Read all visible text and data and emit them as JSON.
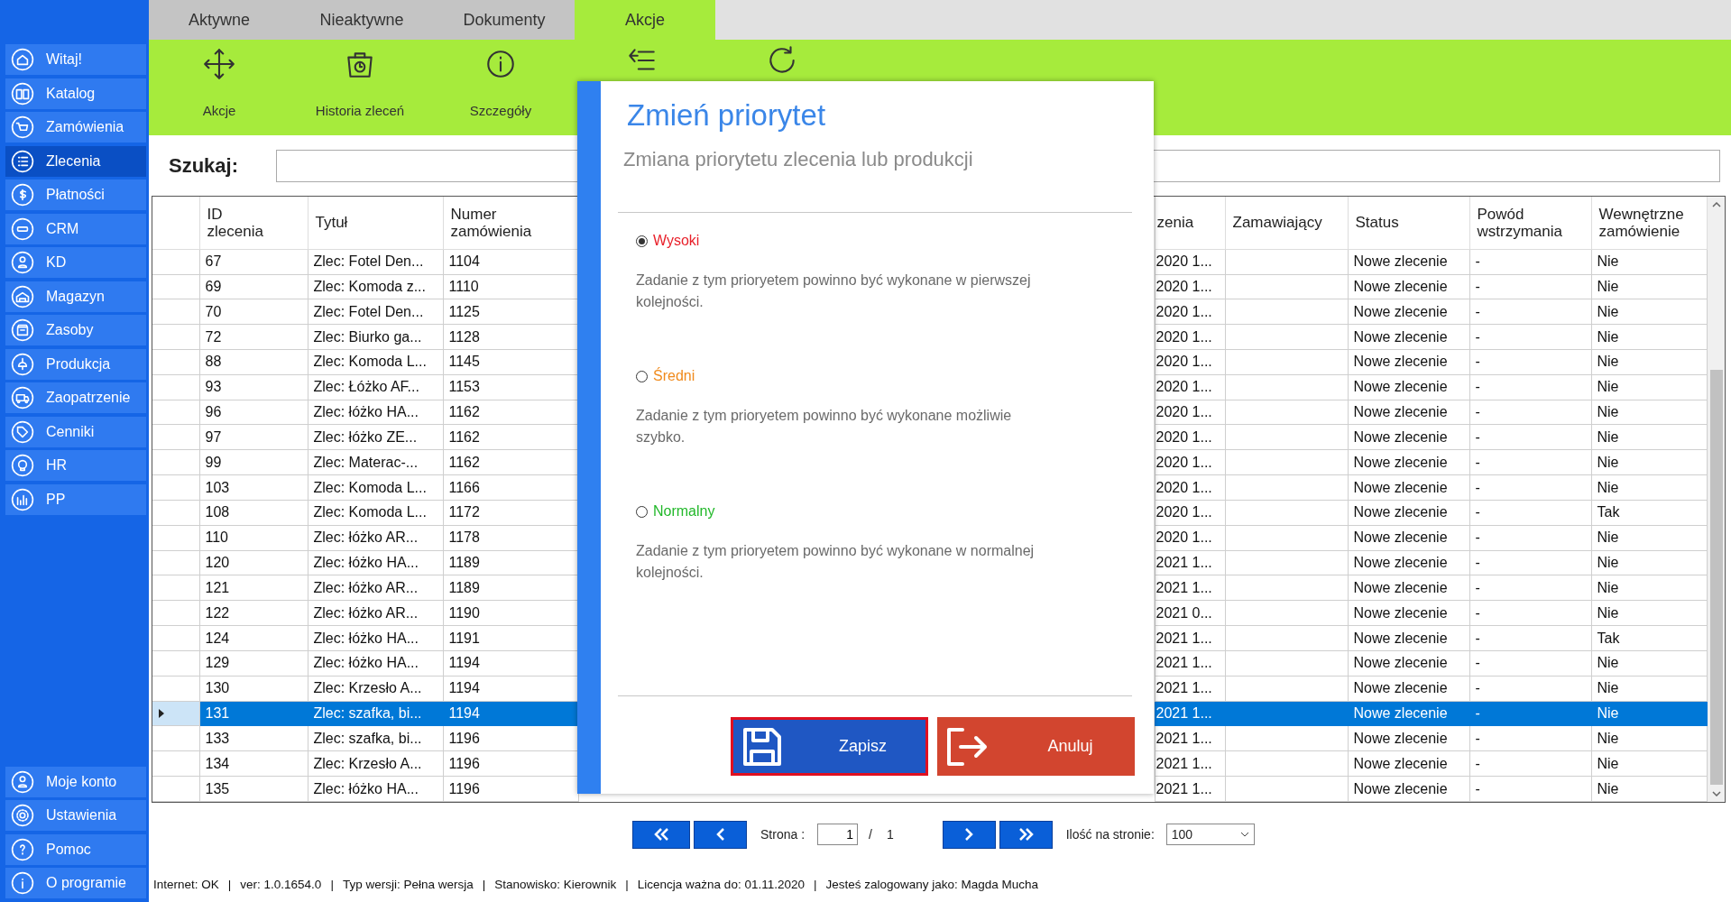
{
  "sidebar": {
    "items": [
      {
        "label": "Witaj!",
        "selected": false
      },
      {
        "label": "Katalog",
        "selected": false
      },
      {
        "label": "Zamówienia",
        "selected": false
      },
      {
        "label": "Zlecenia",
        "selected": true
      },
      {
        "label": "Płatności",
        "selected": false
      },
      {
        "label": "CRM",
        "selected": false
      },
      {
        "label": "KD",
        "selected": false
      },
      {
        "label": "Magazyn",
        "selected": false
      },
      {
        "label": "Zasoby",
        "selected": false
      },
      {
        "label": "Produkcja",
        "selected": false
      },
      {
        "label": "Zaopatrzenie",
        "selected": false
      },
      {
        "label": "Cenniki",
        "selected": false
      },
      {
        "label": "HR",
        "selected": false
      },
      {
        "label": "PP",
        "selected": false
      }
    ],
    "bottom_items": [
      {
        "label": "Moje konto"
      },
      {
        "label": "Ustawienia"
      },
      {
        "label": "Pomoc"
      },
      {
        "label": "O programie"
      }
    ]
  },
  "tabs": [
    {
      "label": "Aktywne",
      "selected": false
    },
    {
      "label": "Nieaktywne",
      "selected": false
    },
    {
      "label": "Dokumenty",
      "selected": false
    },
    {
      "label": "Akcje",
      "selected": true
    }
  ],
  "toolbar": {
    "buttons": [
      {
        "kind": "labeled",
        "label": "Akcje"
      },
      {
        "kind": "labeled",
        "label": "Historia zleceń"
      },
      {
        "kind": "labeled",
        "label": "Szczegóły"
      },
      {
        "kind": "icon_only"
      },
      {
        "kind": "icon_only"
      }
    ]
  },
  "search": {
    "label": "Szukaj:"
  },
  "table": {
    "columns": [
      "ID\nzlecenia",
      "Tytuł",
      "Numer\nzamówienia",
      "zenia",
      "Zamawiający",
      "Status",
      "Powód\nwstrzymania",
      "Wewnętrzne\nzamówienie"
    ],
    "rows": [
      {
        "selected": false,
        "cells": [
          "67",
          "Zlec: Fotel Den...",
          "1104",
          "2020 1...",
          null,
          "Nowe zlecenie",
          "-",
          "Nie"
        ]
      },
      {
        "selected": false,
        "cells": [
          "69",
          "Zlec: Komoda z...",
          "1110",
          "2020 1...",
          null,
          "Nowe zlecenie",
          "-",
          "Nie"
        ]
      },
      {
        "selected": false,
        "cells": [
          "70",
          "Zlec: Fotel Den...",
          "1125",
          "2020 1...",
          null,
          "Nowe zlecenie",
          "-",
          "Nie"
        ]
      },
      {
        "selected": false,
        "cells": [
          "72",
          "Zlec: Biurko ga...",
          "1128",
          "2020 1...",
          null,
          "Nowe zlecenie",
          "-",
          "Nie"
        ]
      },
      {
        "selected": false,
        "cells": [
          "88",
          "Zlec: Komoda L...",
          "1145",
          "2020 1...",
          null,
          "Nowe zlecenie",
          "-",
          "Nie"
        ]
      },
      {
        "selected": false,
        "cells": [
          "93",
          "Zlec: Łóżko AF...",
          "1153",
          "2020 1...",
          null,
          "Nowe zlecenie",
          "-",
          "Nie"
        ]
      },
      {
        "selected": false,
        "cells": [
          "96",
          "Zlec: łóżko HA...",
          "1162",
          "2020 1...",
          null,
          "Nowe zlecenie",
          "-",
          "Nie"
        ]
      },
      {
        "selected": false,
        "cells": [
          "97",
          "Zlec: łóżko ZE...",
          "1162",
          "2020 1...",
          null,
          "Nowe zlecenie",
          "-",
          "Nie"
        ]
      },
      {
        "selected": false,
        "cells": [
          "99",
          "Zlec: Materac-...",
          "1162",
          "2020 1...",
          null,
          "Nowe zlecenie",
          "-",
          "Nie"
        ]
      },
      {
        "selected": false,
        "cells": [
          "103",
          "Zlec: Komoda L...",
          "1166",
          "2020 1...",
          null,
          "Nowe zlecenie",
          "-",
          "Nie"
        ]
      },
      {
        "selected": false,
        "cells": [
          "108",
          "Zlec: Komoda L...",
          "1172",
          "2020 1...",
          null,
          "Nowe zlecenie",
          "-",
          "Tak"
        ]
      },
      {
        "selected": false,
        "cells": [
          "110",
          "Zlec: łóżko AR...",
          "1178",
          "2020 1...",
          null,
          "Nowe zlecenie",
          "-",
          "Nie"
        ]
      },
      {
        "selected": false,
        "cells": [
          "120",
          "Zlec: łóżko HA...",
          "1189",
          "2021 1...",
          null,
          "Nowe zlecenie",
          "-",
          "Nie"
        ]
      },
      {
        "selected": false,
        "cells": [
          "121",
          "Zlec: łóżko AR...",
          "1189",
          "2021 1...",
          null,
          "Nowe zlecenie",
          "-",
          "Nie"
        ]
      },
      {
        "selected": false,
        "cells": [
          "122",
          "Zlec: łóżko AR...",
          "1190",
          "2021 0...",
          null,
          "Nowe zlecenie",
          "-",
          "Nie"
        ]
      },
      {
        "selected": false,
        "cells": [
          "124",
          "Zlec: łóżko HA...",
          "1191",
          "2021 1...",
          null,
          "Nowe zlecenie",
          "-",
          "Tak"
        ]
      },
      {
        "selected": false,
        "cells": [
          "129",
          "Zlec: łóżko HA...",
          "1194",
          "2021 1...",
          null,
          "Nowe zlecenie",
          "-",
          "Nie"
        ]
      },
      {
        "selected": false,
        "cells": [
          "130",
          "Zlec: Krzesło A...",
          "1194",
          "2021 1...",
          null,
          "Nowe zlecenie",
          "-",
          "Nie"
        ]
      },
      {
        "selected": true,
        "cells": [
          "131",
          "Zlec: szafka, bi...",
          "1194",
          "2021 1...",
          null,
          "Nowe zlecenie",
          "-",
          "Nie"
        ]
      },
      {
        "selected": false,
        "cells": [
          "133",
          "Zlec: szafka, bi...",
          "1196",
          "2021 1...",
          null,
          "Nowe zlecenie",
          "-",
          "Nie"
        ]
      },
      {
        "selected": false,
        "cells": [
          "134",
          "Zlec: Krzesło A...",
          "1196",
          "2021 1...",
          null,
          "Nowe zlecenie",
          "-",
          "Nie"
        ]
      },
      {
        "selected": false,
        "cells": [
          "135",
          "Zlec: łóżko HA...",
          "1196",
          "2021 1...",
          null,
          "Nowe zlecenie",
          "-",
          "Nie"
        ]
      }
    ]
  },
  "pagination": {
    "page_label": "Strona :",
    "page": "1",
    "separator": "/",
    "total": "1",
    "per_page_label": "Ilość na stronie:",
    "per_page": "100"
  },
  "status_bar": {
    "separator": "|",
    "items": [
      "Internet: OK",
      "ver: 1.0.1654.0",
      "Typ wersji: Pełna wersja",
      "Stanowisko: Kierownik",
      "Licencja ważna do: 01.11.2020",
      "Jesteś zalogowany jako: Magda Mucha"
    ]
  },
  "dialog": {
    "title": "Zmień priorytet",
    "subtitle": "Zmiana priorytetu zlecenia lub produkcji",
    "options": [
      {
        "label": "Wysoki",
        "color": "#e8202a",
        "selected": true,
        "description": "Zadanie z tym prioryetem powinno być wykonane w pierwszej kolejności."
      },
      {
        "label": "Średni",
        "color": "#f08a1c",
        "selected": false,
        "description": "Zadanie z tym prioryetem powinno być wykonane możliwie szybko."
      },
      {
        "label": "Normalny",
        "color": "#22b82a",
        "selected": false,
        "description": "Zadanie z tym prioryetem powinno być wykonane w normalnej kolejności."
      }
    ],
    "buttons": [
      {
        "kind": "save",
        "label": "Zapisz"
      },
      {
        "kind": "cancel",
        "label": "Anuluj"
      }
    ]
  }
}
